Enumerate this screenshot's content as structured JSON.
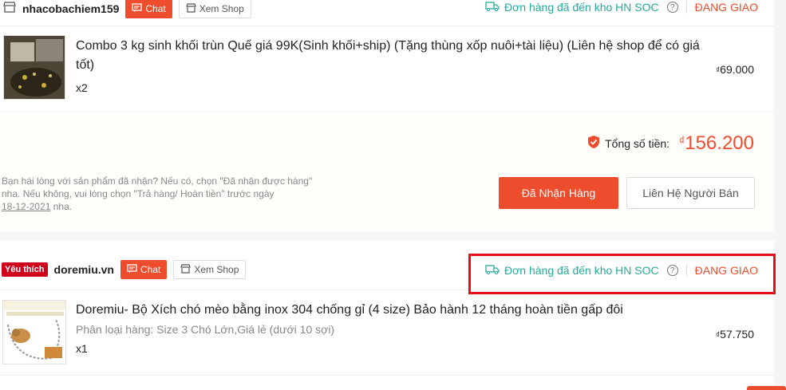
{
  "order1": {
    "shop_name": "nhacobachiem159",
    "chat_label": "Chat",
    "view_shop_label": "Xem Shop",
    "delivery_status": "Đơn hàng đã đến kho HN SOC",
    "order_status": "ĐANG GIAO",
    "product": {
      "name_line1": "Combo 3 kg sinh khối trùn Quế giá 99K(Sinh khối+ship) (Tặng thùng xốp nuôi+tài liệu) (Liên hệ shop để có giá",
      "name_line2": "tốt)",
      "qty": "x2",
      "currency": "₫",
      "price": "69.000"
    },
    "total_label": "Tổng số tiền:",
    "total_currency": "₫",
    "total_value": "156.200",
    "note_line1": "Bạn hài lòng với sản phẩm đã nhận? Nếu có, chọn \"Đã nhận được hàng\"",
    "note_line2": "nha. Nếu không, vui lòng chọn \"Trả hàng/ Hoàn tiền\" trước ngày",
    "note_date": "18-12-2021",
    "note_suffix": " nha.",
    "received_button": "Đã Nhận Hàng",
    "contact_button": "Liên Hệ Người Bán"
  },
  "order2": {
    "badge": "Yêu thích",
    "shop_name": "doremiu.vn",
    "chat_label": "Chat",
    "view_shop_label": "Xem Shop",
    "delivery_status": "Đơn hàng đã đến kho HN SOC",
    "order_status": "ĐANG GIAO",
    "product": {
      "name": "Doremiu- Bộ Xích chó mèo bằng inox 304 chống gỉ (4 size) Bảo hành 12 tháng hoàn tiền gấp đôi",
      "variant": "Phân loại hàng: Size 3 Chó Lớn,Giá lẻ (dưới 10 sợi)",
      "qty": "x1",
      "currency": "₫",
      "price": "57.750"
    }
  },
  "colors": {
    "accent": "#ee4d2d",
    "status_green": "#26aa99",
    "highlight_box": "#e3101c"
  },
  "icons": [
    "shop-icon",
    "chat-icon",
    "storefront-icon",
    "truck-icon",
    "help-icon",
    "shopee-guarantee-icon"
  ]
}
